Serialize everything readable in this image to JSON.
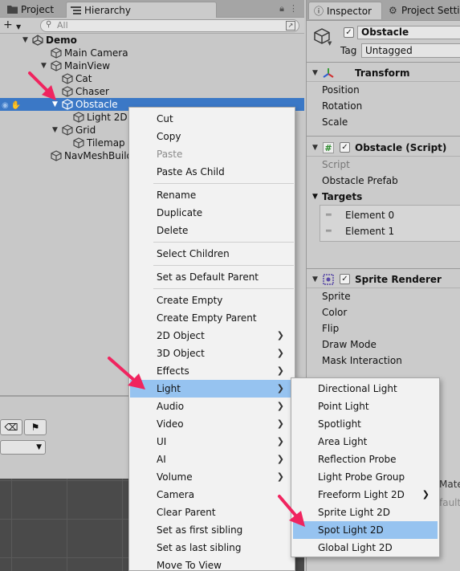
{
  "hierarchy": {
    "tabs": {
      "project": "Project",
      "hierarchy": "Hierarchy"
    },
    "search_placeholder": "All",
    "tree": [
      {
        "label": "Demo",
        "bold": true
      },
      {
        "label": "Main Camera"
      },
      {
        "label": "MainView"
      },
      {
        "label": "Cat"
      },
      {
        "label": "Chaser"
      },
      {
        "label": "Obstacle",
        "selected": true
      },
      {
        "label": "Light 2D"
      },
      {
        "label": "Grid"
      },
      {
        "label": "Tilemap"
      },
      {
        "label": "NavMeshBuild"
      }
    ]
  },
  "inspector": {
    "tabs": {
      "inspector": "Inspector",
      "settings": "Project Settin"
    },
    "object_name": "Obstacle",
    "object_active": true,
    "tag_label": "Tag",
    "tag_value": "Untagged",
    "transform": {
      "title": "Transform",
      "props": [
        "Position",
        "Rotation",
        "Scale"
      ]
    },
    "script": {
      "title": "Obstacle (Script)",
      "enabled": true,
      "script_label": "Script",
      "field": "Obstacle Prefab",
      "targets_label": "Targets",
      "elements": [
        "Element 0",
        "Element 1"
      ]
    },
    "sprite_renderer": {
      "title": "Sprite Renderer",
      "enabled": true,
      "props": [
        "Sprite",
        "Color",
        "Flip",
        "Draw Mode",
        "Mask Interaction"
      ],
      "partial_texts": [
        "Mate",
        "fault"
      ]
    }
  },
  "context_menu": {
    "items": [
      {
        "label": "Cut"
      },
      {
        "label": "Copy"
      },
      {
        "label": "Paste",
        "disabled": true
      },
      {
        "label": "Paste As Child"
      },
      {
        "separator": true
      },
      {
        "label": "Rename"
      },
      {
        "label": "Duplicate"
      },
      {
        "label": "Delete"
      },
      {
        "separator": true
      },
      {
        "label": "Select Children"
      },
      {
        "separator": true
      },
      {
        "label": "Set as Default Parent"
      },
      {
        "separator": true
      },
      {
        "label": "Create Empty"
      },
      {
        "label": "Create Empty Parent"
      },
      {
        "label": "2D Object",
        "submenu": true
      },
      {
        "label": "3D Object",
        "submenu": true
      },
      {
        "label": "Effects",
        "submenu": true
      },
      {
        "label": "Light",
        "submenu": true,
        "highlight": true
      },
      {
        "label": "Audio",
        "submenu": true
      },
      {
        "label": "Video",
        "submenu": true
      },
      {
        "label": "UI",
        "submenu": true
      },
      {
        "label": "AI",
        "submenu": true
      },
      {
        "label": "Volume",
        "submenu": true
      },
      {
        "label": "Camera"
      },
      {
        "label": "Clear Parent"
      },
      {
        "label": "Set as first sibling"
      },
      {
        "label": "Set as last sibling"
      },
      {
        "label": "Move To View"
      }
    ]
  },
  "light_submenu": {
    "items": [
      {
        "label": "Directional Light"
      },
      {
        "label": "Point Light"
      },
      {
        "label": "Spotlight"
      },
      {
        "label": "Area Light"
      },
      {
        "label": "Reflection Probe"
      },
      {
        "label": "Light Probe Group"
      },
      {
        "label": "Freeform Light 2D",
        "submenu": true
      },
      {
        "label": "Sprite Light 2D"
      },
      {
        "label": "Spot Light 2D",
        "highlight": true
      },
      {
        "label": "Global Light 2D"
      }
    ]
  },
  "colors": {
    "selection": "#3b78c6",
    "menu_highlight": "#96c3f0",
    "annotation_arrow": "#f0245f"
  }
}
